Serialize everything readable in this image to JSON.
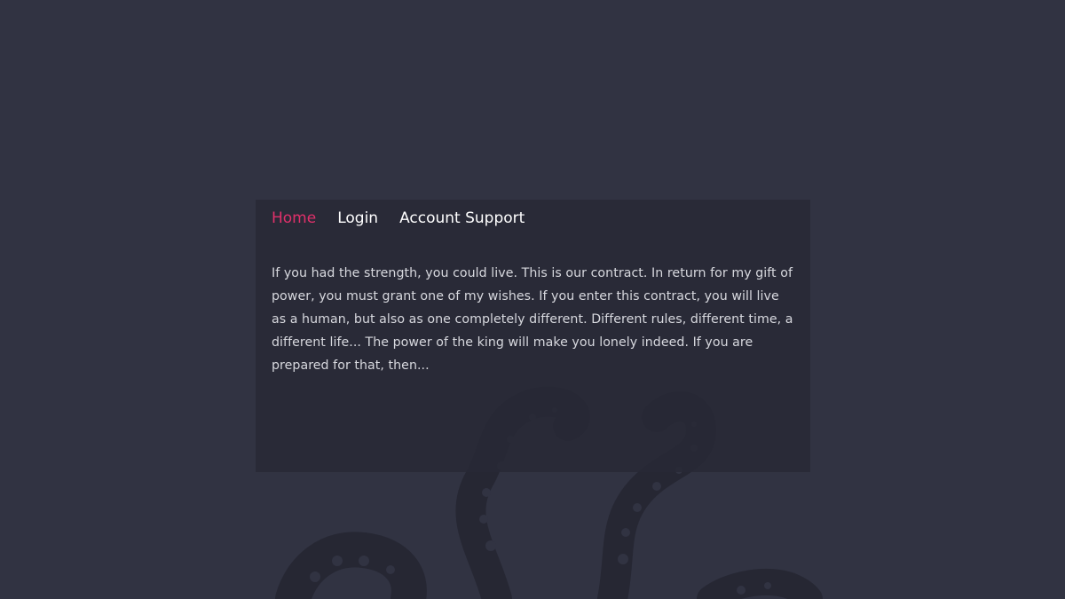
{
  "nav": {
    "items": [
      {
        "label": "Home",
        "active": true
      },
      {
        "label": "Login",
        "active": false
      },
      {
        "label": "Account Support",
        "active": false
      }
    ]
  },
  "main": {
    "text": "If you had the strength, you could live. This is our contract. In return for my gift of power, you must grant one of my wishes. If you enter this contract, you will live as a human, but also as one completely different. Different rules, different time, a different life... The power of the king will make you lonely indeed. If you are prepared for that, then..."
  },
  "colors": {
    "background": "#313342",
    "panel": "#282935",
    "accent": "#e0306a",
    "text": "#d7d8de",
    "nav_text": "#ffffff"
  },
  "icons": {
    "background_art": "tentacle-illustration"
  }
}
